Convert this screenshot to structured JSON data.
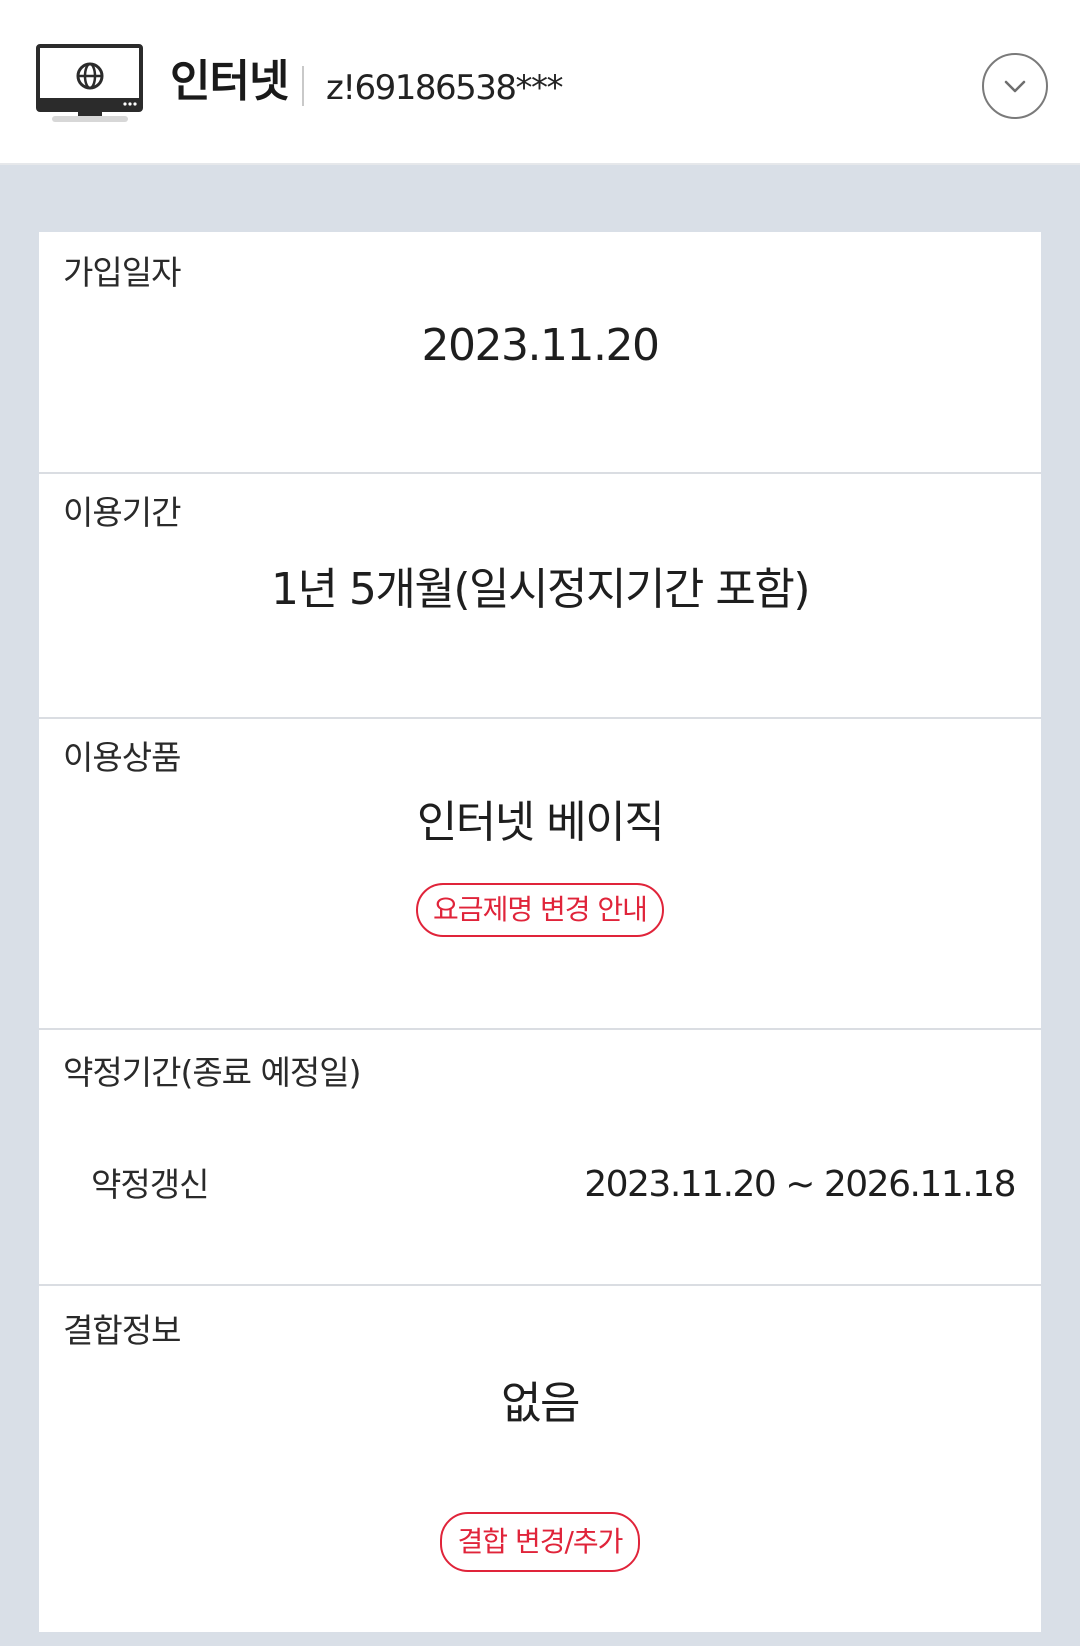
{
  "header": {
    "title": "인터넷",
    "account_id": "z!69186538***",
    "icon": "monitor-globe-icon",
    "expand_icon": "chevron-down-icon"
  },
  "sections": {
    "join_date": {
      "label": "가입일자",
      "value": "2023.11.20"
    },
    "usage_period": {
      "label": "이용기간",
      "value": "1년 5개월(일시정지기간 포함)"
    },
    "product": {
      "label": "이용상품",
      "value": "인터넷 베이직",
      "button": "요금제명 변경 안내"
    },
    "contract": {
      "label": "약정기간(종료 예정일)",
      "row_label": "약정갱신",
      "row_value": "2023.11.20 ~ 2026.11.18"
    },
    "bundle": {
      "label": "결합정보",
      "value": "없음",
      "button": "결합 변경/추가"
    }
  },
  "colors": {
    "accent": "#e0243a",
    "background": "#d9dfe7",
    "card": "#ffffff"
  }
}
